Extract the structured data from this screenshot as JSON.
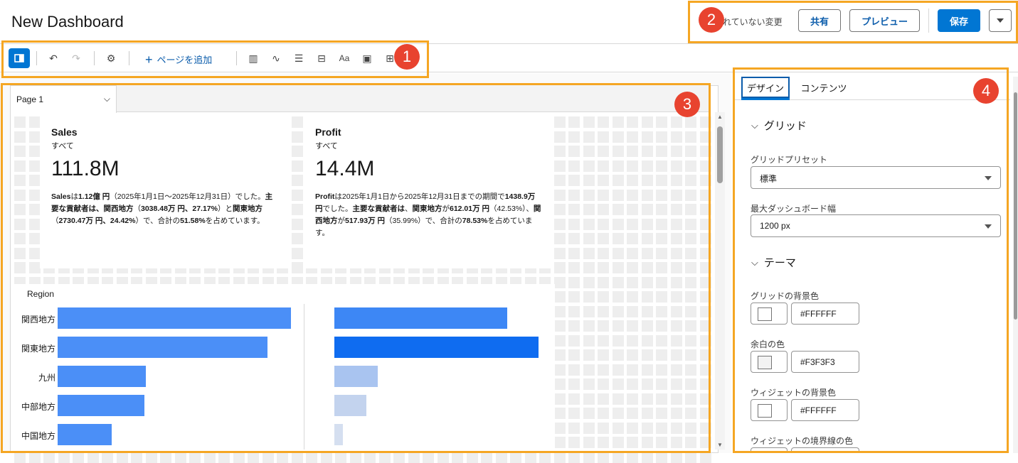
{
  "header": {
    "title": "New Dashboard",
    "unsaved_text": "れていない変更",
    "share_label": "共有",
    "preview_label": "プレビュー",
    "save_label": "保存"
  },
  "toolbar": {
    "add_page_label": "ページを追加"
  },
  "page_tab": {
    "label": "Page 1"
  },
  "kpis": [
    {
      "title": "Sales",
      "filter": "すべて",
      "value": "111.8M",
      "desc_parts": [
        {
          "t": "Sales",
          "b": true
        },
        {
          "t": "は",
          "b": false
        },
        {
          "t": "1.12億 円",
          "b": true
        },
        {
          "t": "（2025年1月1日〜2025年12月31日）でした。",
          "b": false
        },
        {
          "t": "主要な貢献者は、関西地方",
          "b": true
        },
        {
          "t": "（",
          "b": false
        },
        {
          "t": "3038.48万 円、27.17%",
          "b": true
        },
        {
          "t": "）と",
          "b": false
        },
        {
          "t": "関東地方",
          "b": true
        },
        {
          "t": "（",
          "b": false
        },
        {
          "t": "2730.47万 円、24.42%",
          "b": true
        },
        {
          "t": "）で、合計の",
          "b": false
        },
        {
          "t": "51.58%",
          "b": true
        },
        {
          "t": "を占めています。",
          "b": false
        }
      ]
    },
    {
      "title": "Profit",
      "filter": "すべて",
      "value": "14.4M",
      "desc_parts": [
        {
          "t": "Profit",
          "b": true
        },
        {
          "t": "は2025年1月1日から2025年12月31日までの期間で",
          "b": false
        },
        {
          "t": "1438.9万 円",
          "b": true
        },
        {
          "t": "でした。",
          "b": false
        },
        {
          "t": "主要な貢献者は",
          "b": true
        },
        {
          "t": "、",
          "b": false
        },
        {
          "t": "関東地方",
          "b": true
        },
        {
          "t": "が",
          "b": false
        },
        {
          "t": "612.01万 円",
          "b": true
        },
        {
          "t": "（42.53%）、",
          "b": false
        },
        {
          "t": "関西地方",
          "b": true
        },
        {
          "t": "が",
          "b": false
        },
        {
          "t": "517.93万 円",
          "b": true
        },
        {
          "t": "（35.99%）で、合計の",
          "b": false
        },
        {
          "t": "78.53%",
          "b": true
        },
        {
          "t": "を占めています。",
          "b": false
        }
      ]
    }
  ],
  "chart_data": {
    "type": "bar",
    "axis_title": "Region",
    "categories": [
      "関西地方",
      "関東地方",
      "九州",
      "中部地方",
      "中国地方"
    ],
    "series": [
      {
        "values": [
          30.38,
          27.3,
          11.5,
          11.3,
          7.0
        ],
        "color": "#4b8ff7"
      },
      {
        "values": [
          5.18,
          6.12,
          1.3,
          0.95,
          0.25
        ],
        "colors": [
          "#3d87f5",
          "#0f6cf0",
          "#a9c4f0",
          "#c3d3ee",
          "#d5dff0"
        ]
      }
    ]
  },
  "panel": {
    "tab_design": "デザイン",
    "tab_content": "コンテンツ",
    "grid_section": "グリッド",
    "grid_preset_label": "グリッドプリセット",
    "grid_preset_value": "標準",
    "max_width_label": "最大ダッシュボード幅",
    "max_width_value": "1200 px",
    "theme_section": "テーマ",
    "grid_bg_label": "グリッドの背景色",
    "grid_bg_value": "#FFFFFF",
    "margin_color_label": "余白の色",
    "margin_color_value": "#F3F3F3",
    "widget_bg_label": "ウィジェットの背景色",
    "widget_bg_value": "#FFFFFF",
    "widget_border_label": "ウィジェットの境界線の色"
  },
  "annotations": [
    "1",
    "2",
    "3",
    "4"
  ]
}
